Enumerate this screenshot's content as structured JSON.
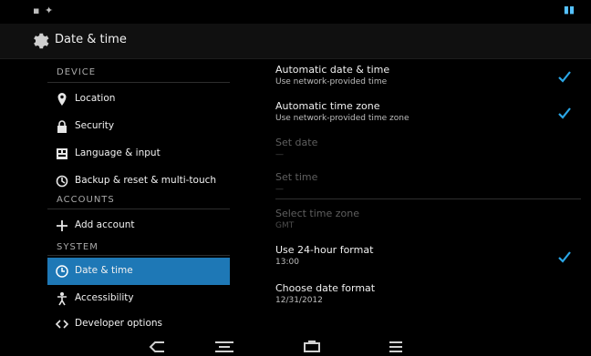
{
  "status": {
    "left": "▪ ✦",
    "right": "▮▮"
  },
  "title": "Date & time",
  "sidebar": {
    "header_1": "Device",
    "items_1": [
      {
        "label": "Location",
        "icon": "location-icon"
      },
      {
        "label": "Security",
        "icon": "lock-icon"
      },
      {
        "label": "Language & input",
        "icon": "keyboard-icon"
      },
      {
        "label": "Backup & reset & multi-touch",
        "icon": "reset-icon"
      }
    ],
    "header_2": "Accounts",
    "add_account": "Add account",
    "header_3": "System",
    "items_2": [
      {
        "label": "Date & time",
        "icon": "clock-icon",
        "active": true
      },
      {
        "label": "Accessibility",
        "icon": "accessibility-icon"
      },
      {
        "label": "Developer options",
        "icon": "developer-icon"
      }
    ]
  },
  "settings": [
    {
      "title": "Automatic date & time",
      "sub": "Use network-provided time",
      "checked": true,
      "disabled": false
    },
    {
      "title": "Automatic time zone",
      "sub": "Use network-provided time zone",
      "checked": true,
      "disabled": false
    },
    {
      "title": "Set date",
      "sub": "—",
      "checked": false,
      "disabled": true
    },
    {
      "title": "Set time",
      "sub": "—",
      "checked": false,
      "disabled": true
    },
    {
      "title": "Select time zone",
      "sub": "GMT",
      "checked": false,
      "disabled": true
    },
    {
      "title": "Use 24-hour format",
      "sub": "13:00",
      "checked": true,
      "disabled": false
    },
    {
      "title": "Choose date format",
      "sub": "12/31/2012",
      "checked": false,
      "disabled": false
    }
  ],
  "nav": [
    "back-icon",
    "home-icon",
    "recent-apps-icon",
    "menu-icon"
  ]
}
